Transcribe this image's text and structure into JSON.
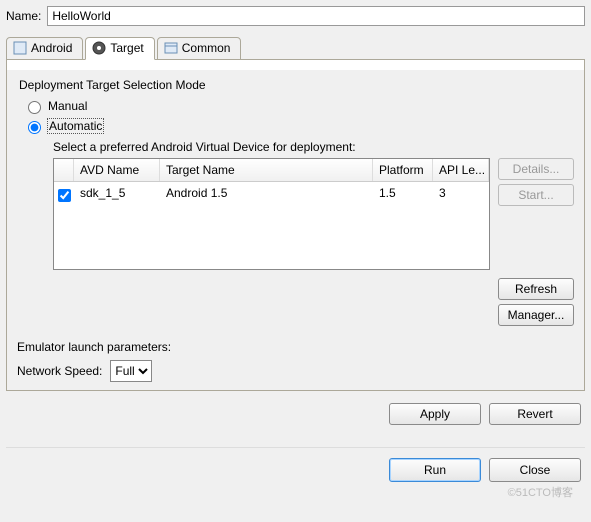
{
  "name_label": "Name:",
  "name_value": "HelloWorld",
  "tabs": {
    "android": "Android",
    "target": "Target",
    "common": "Common"
  },
  "deployment_heading": "Deployment Target Selection Mode",
  "radio_manual": "Manual",
  "radio_automatic": "Automatic",
  "avd_prompt": "Select a preferred Android Virtual Device for deployment:",
  "avd_headers": {
    "avd": "AVD Name",
    "target": "Target Name",
    "platform": "Platform",
    "api": "API Le..."
  },
  "avd_rows": [
    {
      "checked": true,
      "avd": "sdk_1_5",
      "target": "Android 1.5",
      "platform": "1.5",
      "api": "3"
    }
  ],
  "buttons": {
    "details": "Details...",
    "start": "Start...",
    "refresh": "Refresh",
    "manager": "Manager...",
    "apply": "Apply",
    "revert": "Revert",
    "run": "Run",
    "close": "Close"
  },
  "emulator_heading": "Emulator launch parameters:",
  "network_speed_label": "Network Speed:",
  "network_speed_value": "Full",
  "watermark": "©51CTO博客"
}
